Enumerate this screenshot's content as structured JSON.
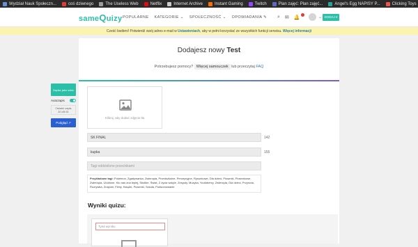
{
  "bookmarks": [
    {
      "label": "Wydział Nauk Społeczn...",
      "color": "#6b8fd6"
    },
    {
      "label": "coś dziwnego",
      "color": "#e53935"
    },
    {
      "label": "The Useless Web",
      "color": "#9e9e9e"
    },
    {
      "label": "Netflix",
      "color": "#e50914"
    },
    {
      "label": "Internet Archive",
      "color": "#cccccc"
    },
    {
      "label": "Instant Gaming",
      "color": "#ff6d00"
    },
    {
      "label": "Twitch",
      "color": "#9146ff"
    },
    {
      "label": "Plan zajęć: Plan zajęć...",
      "color": "#5c6bc0"
    },
    {
      "label": "Angel's Egg NAPISY P...",
      "color": "#26a69a"
    },
    {
      "label": "Clicking Toys",
      "color": "#ef5350"
    }
  ],
  "navbar": {
    "logo_main": "same",
    "logo_q": "Q",
    "logo_end": "uizy",
    "links": [
      "POPULARNE",
      "KATEGORIE ⌄",
      "SPOŁECZNOŚĆ ⌄",
      "OPOWIADANIA ✎"
    ],
    "user_button": "DODAJ ▾"
  },
  "notice": {
    "text": "Cześć bwibmi! Potwierdź swój adres e-mail w",
    "link1": "Ustawieniach",
    "middle": ", aby w pełni korzystać ze wszystkich funkcji serwisu.",
    "link2": "Więcej informacji"
  },
  "editor": {
    "title_prefix": "Dodajesz nowy",
    "title_bold": "Test",
    "help_text": "Potrzebujesz pomocy?",
    "help_button": "Więcej samouczek",
    "help_or": "lub przeczytaj",
    "help_link": "FAQ",
    "image_caption": "Kliknij, aby dodać zdjęcie tła",
    "title_field": "SK FINAL",
    "title_count": "142",
    "desc_field": "kupka",
    "desc_count": "155",
    "tags_placeholder": "Tagi oddzielone przecinkami",
    "tags_heading": "Przykładowe tagi:",
    "tags_list": "Pokémon, Zgadywanka, Zwierzęta, Przedszkolne, Percepcyjne, Rysunkowe, Dla dzieci, Piosenki, Piosenkowe, Zwierzęta, Ulubione, Kto nas zna lepiej, Słodkie, Świat, Z życia wzięte, Zespoły, Muzyka, Youtuberzy, Zwierzęta, Dla dzieci, Przyroda, Rozrywka, Znajomi, Filmy, Książki, Piosenki, Szkoła, Podsumowanie",
    "results_heading": "Wyniki quizu:",
    "result_placeholder": "Tytuł wyniku"
  },
  "sidebar": {
    "save_draft": "Zapisz jako szkic",
    "autosave_label": "Autozapis",
    "saved_line1": "Ostatni zapis",
    "saved_line2": "20:45:51",
    "preview_button": "Podgląd ↗"
  },
  "colors": {
    "brand": "#2bbfa8",
    "notice_bg": "#fbf3b0",
    "link": "#2a7ab0",
    "preview": "#2a5fd1"
  }
}
